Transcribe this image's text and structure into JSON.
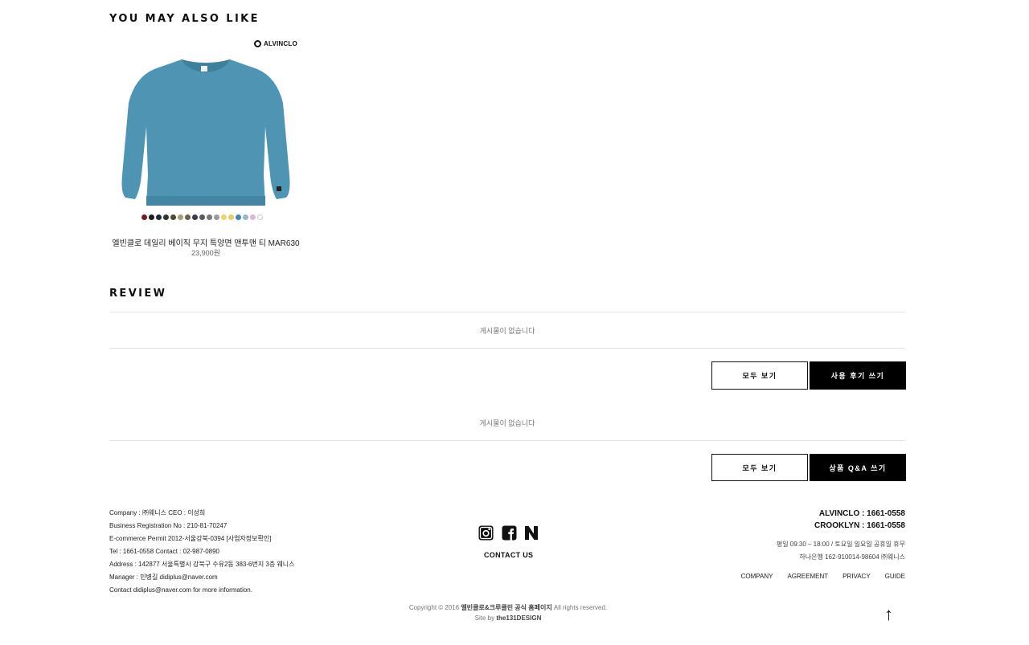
{
  "recommend": {
    "title": "YOU MAY ALSO LIKE",
    "product": {
      "brand_badge": "ALVINCLO",
      "name": "엘빈클로 데일리 베이직 무지 특양면 맨투맨 티 MAR630",
      "price": "23,900원",
      "image_icon": "sweatshirt-image",
      "swatches": [
        "#7a1b24",
        "#1c1c1c",
        "#1f2a44",
        "#2b3a2a",
        "#4a4a2e",
        "#a79b72",
        "#6b6050",
        "#3b3b4e",
        "#5a5a5a",
        "#777777",
        "#9a9a9a",
        "#f0d36a",
        "#e2cf6a",
        "#3f86b0",
        "#9ab6c8",
        "#e3b5d9",
        "#ffffff"
      ]
    }
  },
  "review": {
    "title": "REVIEW",
    "empty_text": "게시물이 없습니다",
    "view_all_label": "모두 보기",
    "write_label": "사용 후기 쓰기"
  },
  "qna": {
    "empty_text": "게시물이 없습니다",
    "view_all_label": "모두 보기",
    "write_label": "상품 Q&A 쓰기"
  },
  "footer": {
    "company_lines": [
      "Company : ㈜웨니스 CEO : 이성희",
      "Business Registration No : 210-81-70247",
      "E-commerce Permit 2012-서울강북-0394 [사업자정보확인]",
      "Tel : 1661-0558 Contact : 02-987-0890",
      "Address : 142877 서울특별시 강북구 수유2동 383-6번지 3층 웨니스",
      "Manager : 민병길 didiplus@naver.com",
      "Contact didiplus@naver.com for more information."
    ],
    "social_icons": [
      "instagram-icon",
      "facebook-icon",
      "naver-icon"
    ],
    "contact_us": "CONTACT US",
    "phones": [
      "ALVINCLO : 1661-0558",
      "CROOKLYN : 1661-0558"
    ],
    "hours": "평일 09:30 – 18:00 / 토요일 일요일 공휴일 휴무",
    "bank": "하나은행 162-910014-98604 ㈜웨니스",
    "links": [
      "COMPANY",
      "AGREEMENT",
      "PRIVACY",
      "GUIDE"
    ],
    "copyright_prefix": "Copyright © 2016",
    "copyright_site": "엘빈클로&크루클린 공식 홈페이지",
    "copyright_suffix": "All rights reserved.",
    "site_by_prefix": "Site by",
    "site_by_name": "the131DESIGN",
    "top_arrow": "↑"
  }
}
